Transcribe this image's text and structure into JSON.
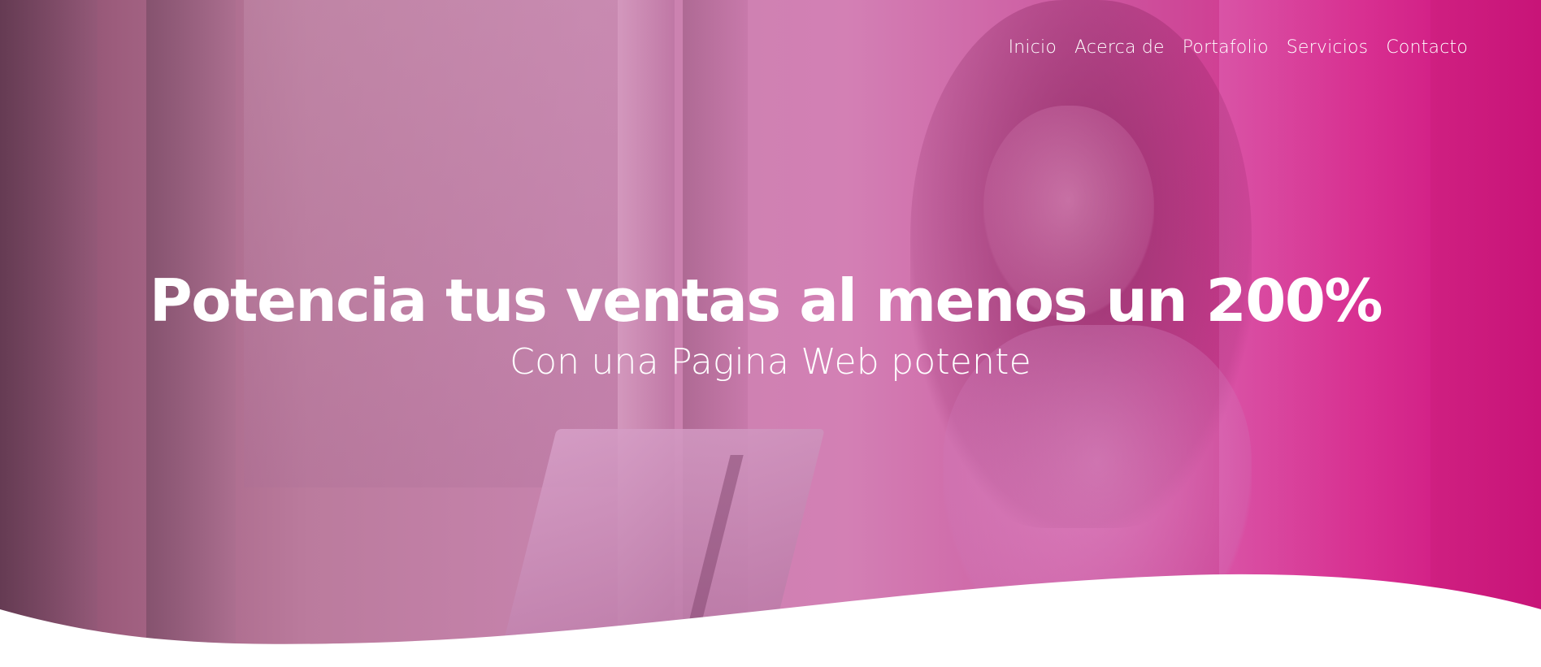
{
  "nav": {
    "items": [
      {
        "label": "Inicio"
      },
      {
        "label": "Acerca de"
      },
      {
        "label": "Portafolio"
      },
      {
        "label": "Servicios"
      },
      {
        "label": "Contacto"
      }
    ]
  },
  "hero": {
    "title": "Potencia tus ventas al menos un 200%",
    "subtitle": "Con una Pagina Web potente"
  },
  "colors": {
    "overlay_primary": "#c2187a",
    "overlay_light": "#d47ab4",
    "text": "#ffffff",
    "page_background": "#ffffff"
  }
}
